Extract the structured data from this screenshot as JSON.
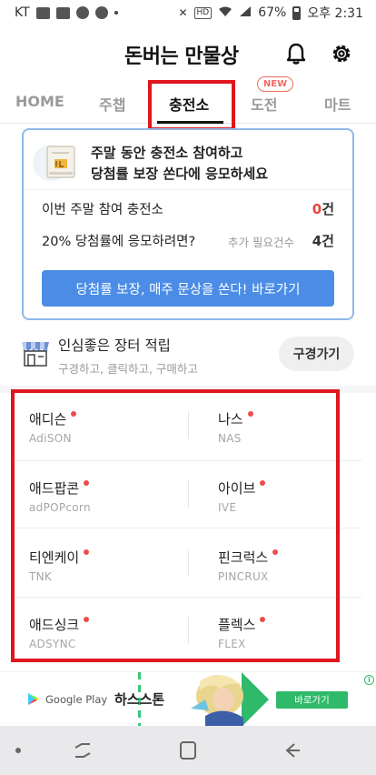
{
  "status_bar": {
    "carrier": "KT",
    "battery": "67%",
    "time": "오후 2:31",
    "hd_label": "HD"
  },
  "header": {
    "title": "돈버는 만물상",
    "icons": [
      "bell-icon",
      "gear-icon"
    ]
  },
  "tabs": [
    {
      "label": "HOME",
      "active": false
    },
    {
      "label": "주챕",
      "active": false
    },
    {
      "label": "충전소",
      "active": true
    },
    {
      "label": "도전",
      "active": false,
      "badge": "NEW"
    },
    {
      "label": "마트",
      "active": false
    }
  ],
  "event_card": {
    "headline_line1": "주말 동안 충전소 참여하고",
    "headline_line2": "당첨률 보장 쏜다에 응모하세요",
    "row1_label": "이번 주말 참여 충전소",
    "row1_value": "0",
    "row1_unit": "건",
    "row2_label": "20% 당첨률에 응모하려면?",
    "row2_extra": "추가 필요건수",
    "row2_value": "4건",
    "button_label": "당첨률 보장, 매주 문상을 쏜다! 바로가기"
  },
  "shop": {
    "title": "인심좋은 장터 적립",
    "subtitle": "구경하고, 클릭하고, 구매하고",
    "button_label": "구경가기"
  },
  "partners": [
    {
      "name": "애디슨",
      "sub": "AdiSON"
    },
    {
      "name": "나스",
      "sub": "NAS"
    },
    {
      "name": "애드팝콘",
      "sub": "adPOPcorn"
    },
    {
      "name": "아이브",
      "sub": "IVE"
    },
    {
      "name": "티엔케이",
      "sub": "TNK"
    },
    {
      "name": "핀크럭스",
      "sub": "PINCRUX"
    },
    {
      "name": "애드싱크",
      "sub": "ADSYNC"
    },
    {
      "name": "플렉스",
      "sub": "FLEX"
    }
  ],
  "ad": {
    "store_label": "Google Play",
    "brand": "하스스톤",
    "button_label": "바로가기",
    "info_label": "i"
  },
  "colors": {
    "accent_blue": "#4b8de6",
    "highlight_red": "#e0161f",
    "dot_red": "#ef4b4b",
    "ad_green": "#2fb96a"
  }
}
